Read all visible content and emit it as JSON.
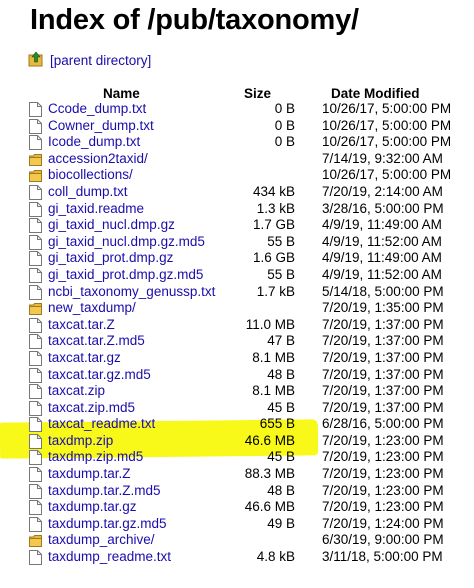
{
  "page": {
    "title": "Index of /pub/taxonomy/",
    "parent_link": "[parent directory]"
  },
  "table": {
    "headers": {
      "name": "Name",
      "size": "Size",
      "date": "Date Modified"
    },
    "rows": [
      {
        "name": "Ccode_dump.txt",
        "size": "0 B",
        "date": "10/26/17, 5:00:00 PM",
        "type": "file"
      },
      {
        "name": "Cowner_dump.txt",
        "size": "0 B",
        "date": "10/26/17, 5:00:00 PM",
        "type": "file"
      },
      {
        "name": "Icode_dump.txt",
        "size": "0 B",
        "date": "10/26/17, 5:00:00 PM",
        "type": "file"
      },
      {
        "name": "accession2taxid/",
        "size": "",
        "date": "7/14/19, 9:32:00 AM",
        "type": "folder"
      },
      {
        "name": "biocollections/",
        "size": "",
        "date": "10/26/17, 5:00:00 PM",
        "type": "folder"
      },
      {
        "name": "coll_dump.txt",
        "size": "434 kB",
        "date": "7/20/19, 2:14:00 AM",
        "type": "file"
      },
      {
        "name": "gi_taxid.readme",
        "size": "1.3 kB",
        "date": "3/28/16, 5:00:00 PM",
        "type": "file"
      },
      {
        "name": "gi_taxid_nucl.dmp.gz",
        "size": "1.7 GB",
        "date": "4/9/19, 11:49:00 AM",
        "type": "file"
      },
      {
        "name": "gi_taxid_nucl.dmp.gz.md5",
        "size": "55 B",
        "date": "4/9/19, 11:52:00 AM",
        "type": "file"
      },
      {
        "name": "gi_taxid_prot.dmp.gz",
        "size": "1.6 GB",
        "date": "4/9/19, 11:49:00 AM",
        "type": "file"
      },
      {
        "name": "gi_taxid_prot.dmp.gz.md5",
        "size": "55 B",
        "date": "4/9/19, 11:52:00 AM",
        "type": "file"
      },
      {
        "name": "ncbi_taxonomy_genussp.txt",
        "size": "1.7 kB",
        "date": "5/14/18, 5:00:00 PM",
        "type": "file"
      },
      {
        "name": "new_taxdump/",
        "size": "",
        "date": "7/20/19, 1:35:00 PM",
        "type": "folder"
      },
      {
        "name": "taxcat.tar.Z",
        "size": "11.0 MB",
        "date": "7/20/19, 1:37:00 PM",
        "type": "file"
      },
      {
        "name": "taxcat.tar.Z.md5",
        "size": "47 B",
        "date": "7/20/19, 1:37:00 PM",
        "type": "file"
      },
      {
        "name": "taxcat.tar.gz",
        "size": "8.1 MB",
        "date": "7/20/19, 1:37:00 PM",
        "type": "file"
      },
      {
        "name": "taxcat.tar.gz.md5",
        "size": "48 B",
        "date": "7/20/19, 1:37:00 PM",
        "type": "file"
      },
      {
        "name": "taxcat.zip",
        "size": "8.1 MB",
        "date": "7/20/19, 1:37:00 PM",
        "type": "file"
      },
      {
        "name": "taxcat.zip.md5",
        "size": "45 B",
        "date": "7/20/19, 1:37:00 PM",
        "type": "file"
      },
      {
        "name": "taxcat_readme.txt",
        "size": "655 B",
        "date": "6/28/16, 5:00:00 PM",
        "type": "file"
      },
      {
        "name": "taxdmp.zip",
        "size": "46.6 MB",
        "date": "7/20/19, 1:23:00 PM",
        "type": "file"
      },
      {
        "name": "taxdmp.zip.md5",
        "size": "45 B",
        "date": "7/20/19, 1:23:00 PM",
        "type": "file"
      },
      {
        "name": "taxdump.tar.Z",
        "size": "88.3 MB",
        "date": "7/20/19, 1:23:00 PM",
        "type": "file"
      },
      {
        "name": "taxdump.tar.Z.md5",
        "size": "48 B",
        "date": "7/20/19, 1:23:00 PM",
        "type": "file"
      },
      {
        "name": "taxdump.tar.gz",
        "size": "46.6 MB",
        "date": "7/20/19, 1:23:00 PM",
        "type": "file"
      },
      {
        "name": "taxdump.tar.gz.md5",
        "size": "49 B",
        "date": "7/20/19, 1:24:00 PM",
        "type": "file"
      },
      {
        "name": "taxdump_archive/",
        "size": "",
        "date": "6/30/19, 9:00:00 PM",
        "type": "folder"
      },
      {
        "name": "taxdump_readme.txt",
        "size": "4.8 kB",
        "date": "3/11/18, 5:00:00 PM",
        "type": "file"
      }
    ]
  },
  "highlight": {
    "color": "#f7f700"
  },
  "colors": {
    "link": "#1a0dab",
    "folder": "#e8b93a"
  }
}
